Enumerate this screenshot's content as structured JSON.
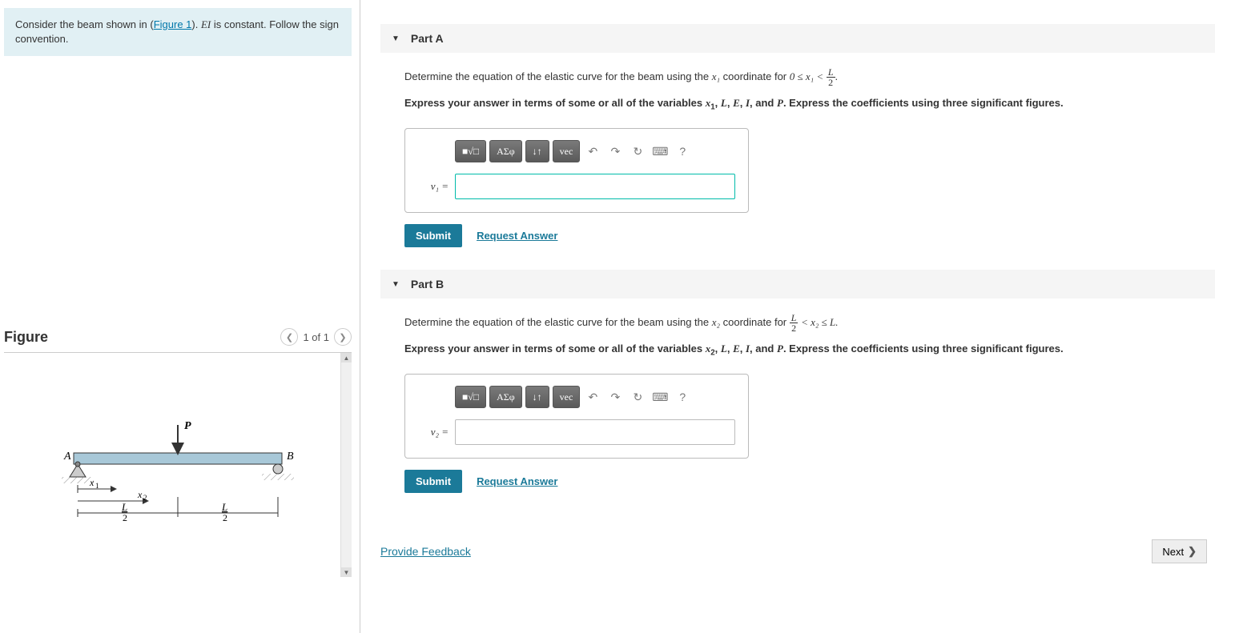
{
  "problem": {
    "prefix": "Consider the beam shown in (",
    "figure_link": "Figure 1",
    "suffix_1": "). ",
    "ei_var": "EI",
    "suffix_2": " is constant. Follow the sign convention."
  },
  "figure": {
    "title": "Figure",
    "pager": "1 of 1",
    "labels": {
      "A": "A",
      "B": "B",
      "P": "P",
      "x1": "x₁",
      "x2": "x₂",
      "L": "L",
      "two": "2"
    }
  },
  "partA": {
    "header": "Part A",
    "q_prefix": "Determine the equation of the elastic curve for the beam using the ",
    "q_var": "x₁",
    "q_mid": " coordinate for ",
    "range_left": "0 ≤ x₁ <",
    "frac_num": "L",
    "frac_den": "2",
    "range_end": ".",
    "instruction": "Express your answer in terms of some or all of the variables x₁, L, E, I, and P. Express the coefficients using three significant figures.",
    "answer_label": "v₁ =",
    "submit": "Submit",
    "request": "Request Answer"
  },
  "partB": {
    "header": "Part B",
    "q_prefix": "Determine the equation of the elastic curve for the beam using the ",
    "q_var": "x₂",
    "q_mid": " coordinate for ",
    "frac_num": "L",
    "frac_den": "2",
    "range_right": "< x₂ ≤ L.",
    "instruction": "Express your answer in terms of some or all of the variables x₂, L, E, I, and P. Express the coefficients using three significant figures.",
    "answer_label": "v₂ =",
    "submit": "Submit",
    "request": "Request Answer"
  },
  "toolbar": {
    "templates": "■√□",
    "greek": "ΑΣφ",
    "subsup": "↓↑",
    "vec": "vec",
    "undo_icon": "↶",
    "redo_icon": "↷",
    "reset_icon": "↻",
    "keyboard_icon": "⌨",
    "help_icon": "?"
  },
  "footer": {
    "feedback": "Provide Feedback",
    "next": "Next"
  }
}
